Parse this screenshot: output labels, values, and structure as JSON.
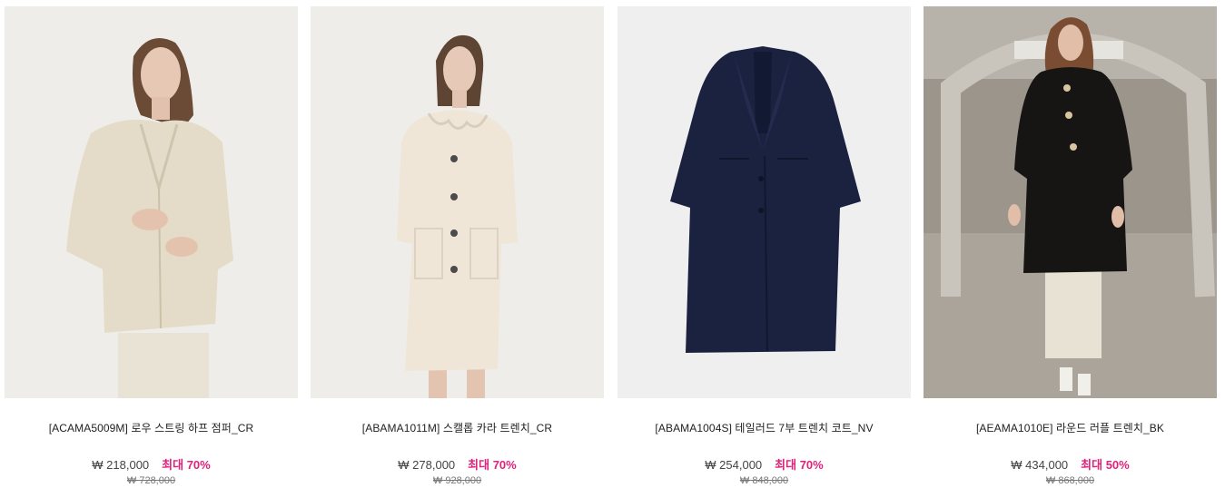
{
  "products": [
    {
      "name": "[ACAMA5009M] 로우 스트링 하프 점퍼_CR",
      "price": "₩ 218,000",
      "discount": "최대 70%",
      "original_price": "₩ 728,000",
      "bg": "#eeece8",
      "garment": "#e8e0cf"
    },
    {
      "name": "[ABAMA1011M] 스캘롭 카라 트렌치_CR",
      "price": "₩ 278,000",
      "discount": "최대 70%",
      "original_price": "₩ 928,000",
      "bg": "#eeedea",
      "garment": "#efe6d8"
    },
    {
      "name": "[ABAMA1004S] 테일러드 7부 트렌치 코트_NV",
      "price": "₩ 254,000",
      "discount": "최대 70%",
      "original_price": "₩ 848,000",
      "bg": "#eeeeef",
      "garment": "#1a2240"
    },
    {
      "name": "[AEAMA1010E] 라운드 러플 트렌치_BK",
      "price": "₩ 434,000",
      "discount": "최대 50%",
      "original_price": "₩ 868,000",
      "bg": "#a9a49c",
      "garment": "#161514"
    }
  ],
  "colors": {
    "discount": "#e0227a"
  }
}
